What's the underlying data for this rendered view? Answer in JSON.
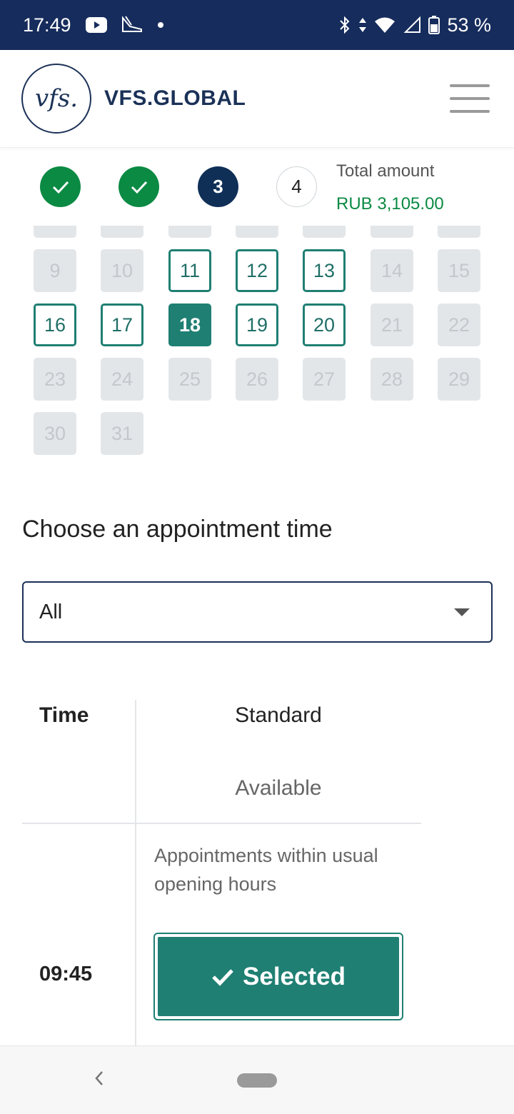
{
  "status_bar": {
    "time": "17:49",
    "battery": "53 %",
    "icons": [
      "youtube-icon",
      "app-icon",
      "dot-icon",
      "bluetooth-icon",
      "data-arrows-icon",
      "wifi-icon",
      "signal-icon",
      "battery-icon"
    ]
  },
  "header": {
    "logo_text": "vfs.",
    "brand": "VFS.GLOBAL",
    "menu_icon": "hamburger-icon"
  },
  "steps": {
    "items": [
      {
        "label": "",
        "state": "done"
      },
      {
        "label": "",
        "state": "done"
      },
      {
        "label": "3",
        "state": "current"
      },
      {
        "label": "4",
        "state": "todo"
      }
    ],
    "total_label": "Total amount",
    "total_value": "RUB 3,105.00"
  },
  "calendar": {
    "rows": [
      [
        {
          "d": "9",
          "s": "dis"
        },
        {
          "d": "10",
          "s": "dis"
        },
        {
          "d": "11",
          "s": "avail"
        },
        {
          "d": "12",
          "s": "avail"
        },
        {
          "d": "13",
          "s": "avail"
        },
        {
          "d": "14",
          "s": "dis"
        },
        {
          "d": "15",
          "s": "dis"
        }
      ],
      [
        {
          "d": "16",
          "s": "avail"
        },
        {
          "d": "17",
          "s": "avail"
        },
        {
          "d": "18",
          "s": "sel"
        },
        {
          "d": "19",
          "s": "avail"
        },
        {
          "d": "20",
          "s": "avail"
        },
        {
          "d": "21",
          "s": "dis"
        },
        {
          "d": "22",
          "s": "dis"
        }
      ],
      [
        {
          "d": "23",
          "s": "dis"
        },
        {
          "d": "24",
          "s": "dis"
        },
        {
          "d": "25",
          "s": "dis"
        },
        {
          "d": "26",
          "s": "dis"
        },
        {
          "d": "27",
          "s": "dis"
        },
        {
          "d": "28",
          "s": "dis"
        },
        {
          "d": "29",
          "s": "dis"
        }
      ],
      [
        {
          "d": "30",
          "s": "dis"
        },
        {
          "d": "31",
          "s": "dis"
        }
      ]
    ]
  },
  "appointment": {
    "title": "Choose an appointment time",
    "filter_value": "All"
  },
  "table": {
    "col_time": "Time",
    "col_standard": "Standard",
    "col_available": "Available",
    "description": "Appointments within usual opening hours",
    "rows": [
      {
        "time": "09:45",
        "button_label": "Selected"
      }
    ]
  },
  "colors": {
    "status_bar": "#162c5c",
    "brand": "#1b3157",
    "success": "#0b8a43",
    "accent": "#1f7f73"
  }
}
